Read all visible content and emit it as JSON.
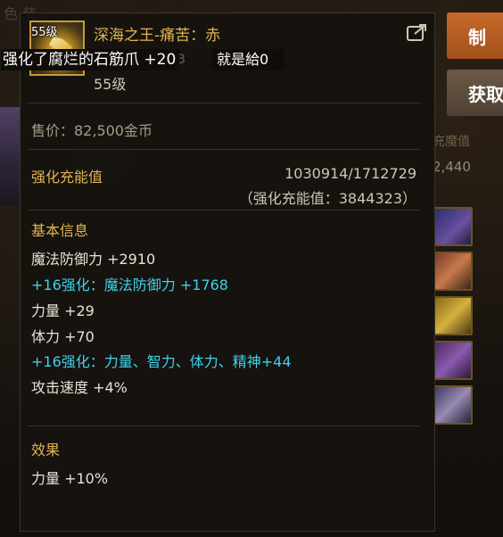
{
  "background": {
    "left_text": "色 装",
    "right_text_1": "充魔值",
    "right_text_2": "2,440"
  },
  "side_buttons": {
    "primary_label": "制",
    "secondary_label": "获取"
  },
  "item": {
    "level_badge": "55级",
    "name": "深海之王-痛苦：赤",
    "enhance_banner": "强化了腐烂的石筋爪 +20",
    "faint_number": "3",
    "chat_text": "就是給0",
    "level": "55级",
    "price": "售价：82,500金币"
  },
  "charge": {
    "label": "强化充能值",
    "value": "1030914/1712729",
    "sub": "（强化充能值：3844323）"
  },
  "basic_info": {
    "title": "基本信息",
    "stats": [
      {
        "text": "魔法防御力 +2910",
        "color": "white"
      },
      {
        "text": "+16强化：魔法防御力 +1768",
        "color": "cyan"
      },
      {
        "text": "力量 +29",
        "color": "white"
      },
      {
        "text": "体力 +70",
        "color": "white"
      },
      {
        "text": "+16强化：力量、智力、体力、精神+44",
        "color": "cyan"
      },
      {
        "text": "攻击速度 +4%",
        "color": "white"
      }
    ]
  },
  "effect": {
    "title": "效果",
    "stats": [
      {
        "text": "力量 +10%",
        "color": "white"
      }
    ]
  },
  "colors": {
    "gold": "#e2b44f",
    "cyan": "#3fd1ea",
    "panel": "#161310",
    "button_orange": "#c66a2a"
  }
}
